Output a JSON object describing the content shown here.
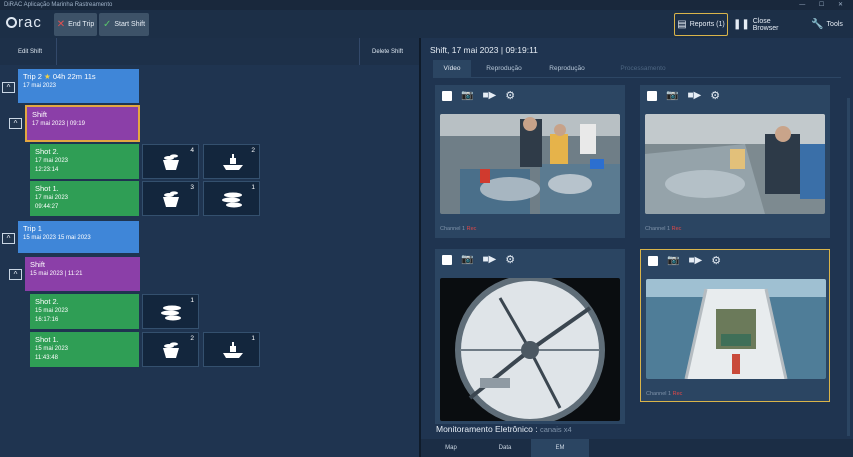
{
  "window": {
    "title": "DiRAC Aplicação Marinha Rastreamento",
    "controls": "— ☐ ✕"
  },
  "toolbar": {
    "logo": "rac",
    "end_trip": "End Trip",
    "start_shift": "Start Shift",
    "reports": "Reports (1)",
    "close_browser": "Close Browser",
    "tools": "Tools"
  },
  "left": {
    "edit_shift": "Edit Shift",
    "delete_shift": "Delete Shift",
    "trip2": {
      "title": "Trip 2",
      "duration": "04h 22m 11s",
      "date": "17 mai 2023"
    },
    "shift2": {
      "title": "Shift",
      "date": "17 mai 2023 | 09:19"
    },
    "shot2a": {
      "title": "Shot 2.",
      "date": "17 mai 2023",
      "time": "12:23:14",
      "count1": "4",
      "count2": "2"
    },
    "shot2b": {
      "title": "Shot 1.",
      "date": "17 mai 2023",
      "time": "09:44:27",
      "count1": "3",
      "count2": "1"
    },
    "trip1": {
      "title": "Trip 1",
      "date": "15 mai 2023 15 mai 2023"
    },
    "shift1": {
      "title": "Shift",
      "date": "15 mai 2023 | 11:21"
    },
    "shot1a": {
      "title": "Shot 2.",
      "date": "15 mai 2023",
      "time": "16:17:16",
      "count1": "1"
    },
    "shot1b": {
      "title": "Shot 1.",
      "date": "15 mai 2023",
      "time": "11:43:48",
      "count1": "2",
      "count2": "1"
    }
  },
  "right": {
    "title": "Shift, 17 mai 2023 | 09:19:11",
    "tabs": [
      "Vídeo",
      "Reprodução",
      "Reprodução",
      "Processamento"
    ],
    "channel_label": "Channel 1",
    "channel_status": "Rec",
    "em_title": "Monitoramento Eletrônico :",
    "em_sub": "canais x4",
    "nav": [
      "Map",
      "Data",
      "EM"
    ]
  },
  "colors": {
    "trip": "#3f86d8",
    "shift": "#8b3fa8",
    "shot": "#2f9e55",
    "accent": "#d9b44a"
  }
}
